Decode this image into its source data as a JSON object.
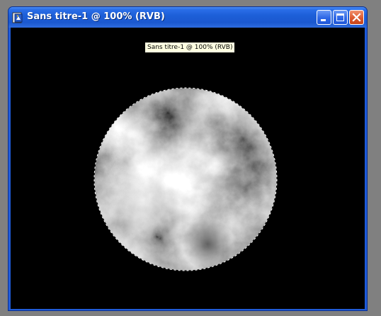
{
  "window": {
    "title": "Sans titre-1 @ 100% (RVB)",
    "tooltip": "Sans titre-1 @ 100% (RVB)",
    "icons": [
      "photoshop-document-icon",
      "minimize-icon",
      "maximize-icon",
      "close-icon"
    ]
  },
  "canvas": {
    "background": "#000000",
    "content": "clouds-filled-circle-selection",
    "selection": "marching-ants"
  },
  "colors": {
    "titlebar": "#1f5bd8",
    "close_button": "#dc5a30",
    "tooltip_bg": "#ffffe1"
  }
}
